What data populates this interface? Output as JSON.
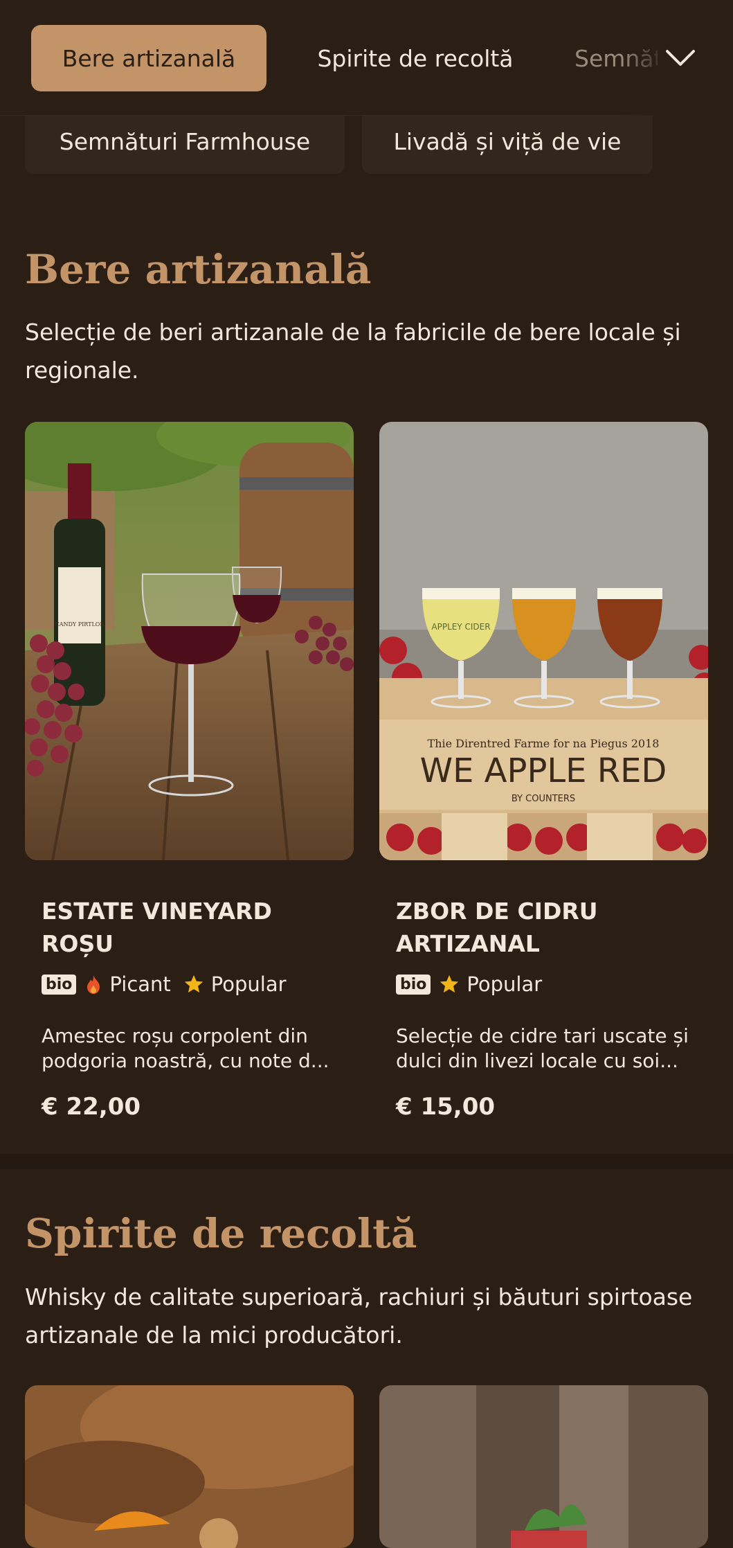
{
  "tabs": [
    {
      "label": "Bere artizanală",
      "active": true
    },
    {
      "label": "Spirite de recoltă",
      "active": false
    },
    {
      "label": "Semnături Farmhouse",
      "active": false
    }
  ],
  "pills": [
    {
      "label": "Semnături Farmhouse"
    },
    {
      "label": "Livadă și viță de vie"
    }
  ],
  "sections": [
    {
      "title": "Bere artizanală",
      "description": "Selecție de beri artizanale de la fabricile de bere locale și regionale.",
      "items": [
        {
          "name": "Estate Vineyard Roșu",
          "bio": "bio",
          "tags": [
            "Picant",
            "Popular"
          ],
          "description": "Amestec roșu corpolent din podgoria noastră, cu note d...",
          "price": "€ 22,00"
        },
        {
          "name": "Zbor de cidru artizanal",
          "bio": "bio",
          "tags": [
            "Popular"
          ],
          "description": "Selecție de cidre tari uscate și dulci din livezi locale cu soi...",
          "price": "€ 15,00",
          "image_text": {
            "line1": "Thie Direntred Farme for na Piegus 2018",
            "line2": "WE APPLE RED",
            "line3": "BY COUNTERS",
            "glass": "APPLEY CIDER"
          }
        }
      ]
    },
    {
      "title": "Spirite de recoltă",
      "description": "Whisky de calitate superioară, rachiuri și băuturi spirtoase artizanale de la mici producători."
    }
  ],
  "wine_label": "CANDY PIRTLOR",
  "colors": {
    "accent": "#c39468",
    "background": "#2a1e15",
    "star": "#f3b517",
    "flame": "#e8542a"
  }
}
